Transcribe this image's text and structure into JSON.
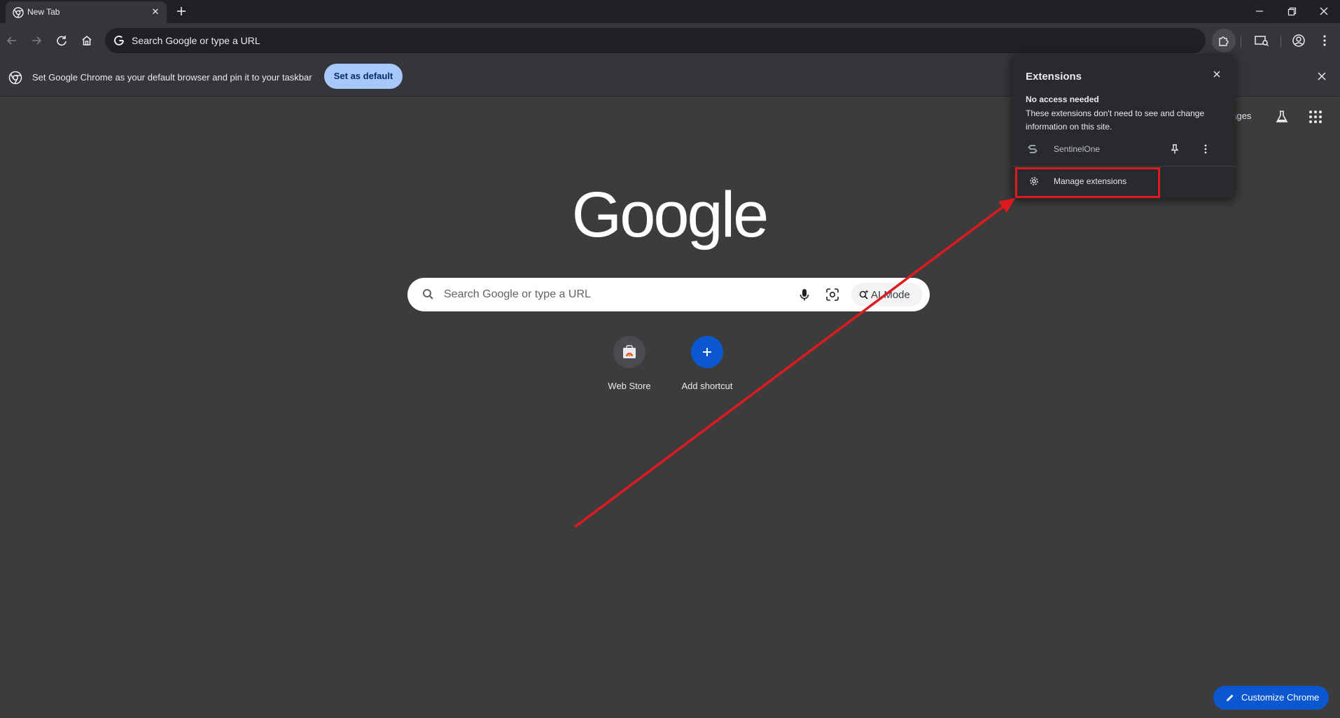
{
  "tab": {
    "title": "New Tab"
  },
  "omnibox": {
    "text": "Search Google or type a URL"
  },
  "infobar": {
    "message": "Set Google Chrome as your default browser and pin it to your taskbar",
    "button": "Set as default"
  },
  "ntp": {
    "images_link": "nages",
    "logo": "Google",
    "search_placeholder": "Search Google or type a URL",
    "ai_mode": "AI Mode",
    "shortcuts": [
      {
        "label": "Web Store"
      },
      {
        "label": "Add shortcut"
      }
    ],
    "customize": "Customize Chrome"
  },
  "extensions_popup": {
    "title": "Extensions",
    "section_title": "No access needed",
    "section_desc": "These extensions don't need to see and change information on this site.",
    "items": [
      {
        "name": "SentinelOne"
      }
    ],
    "manage": "Manage extensions"
  },
  "colors": {
    "background": "#3c3c3c",
    "accent_blue": "#0b57d0",
    "set_default_bg": "#a8c7fa",
    "annotation_red": "#e0191f"
  }
}
